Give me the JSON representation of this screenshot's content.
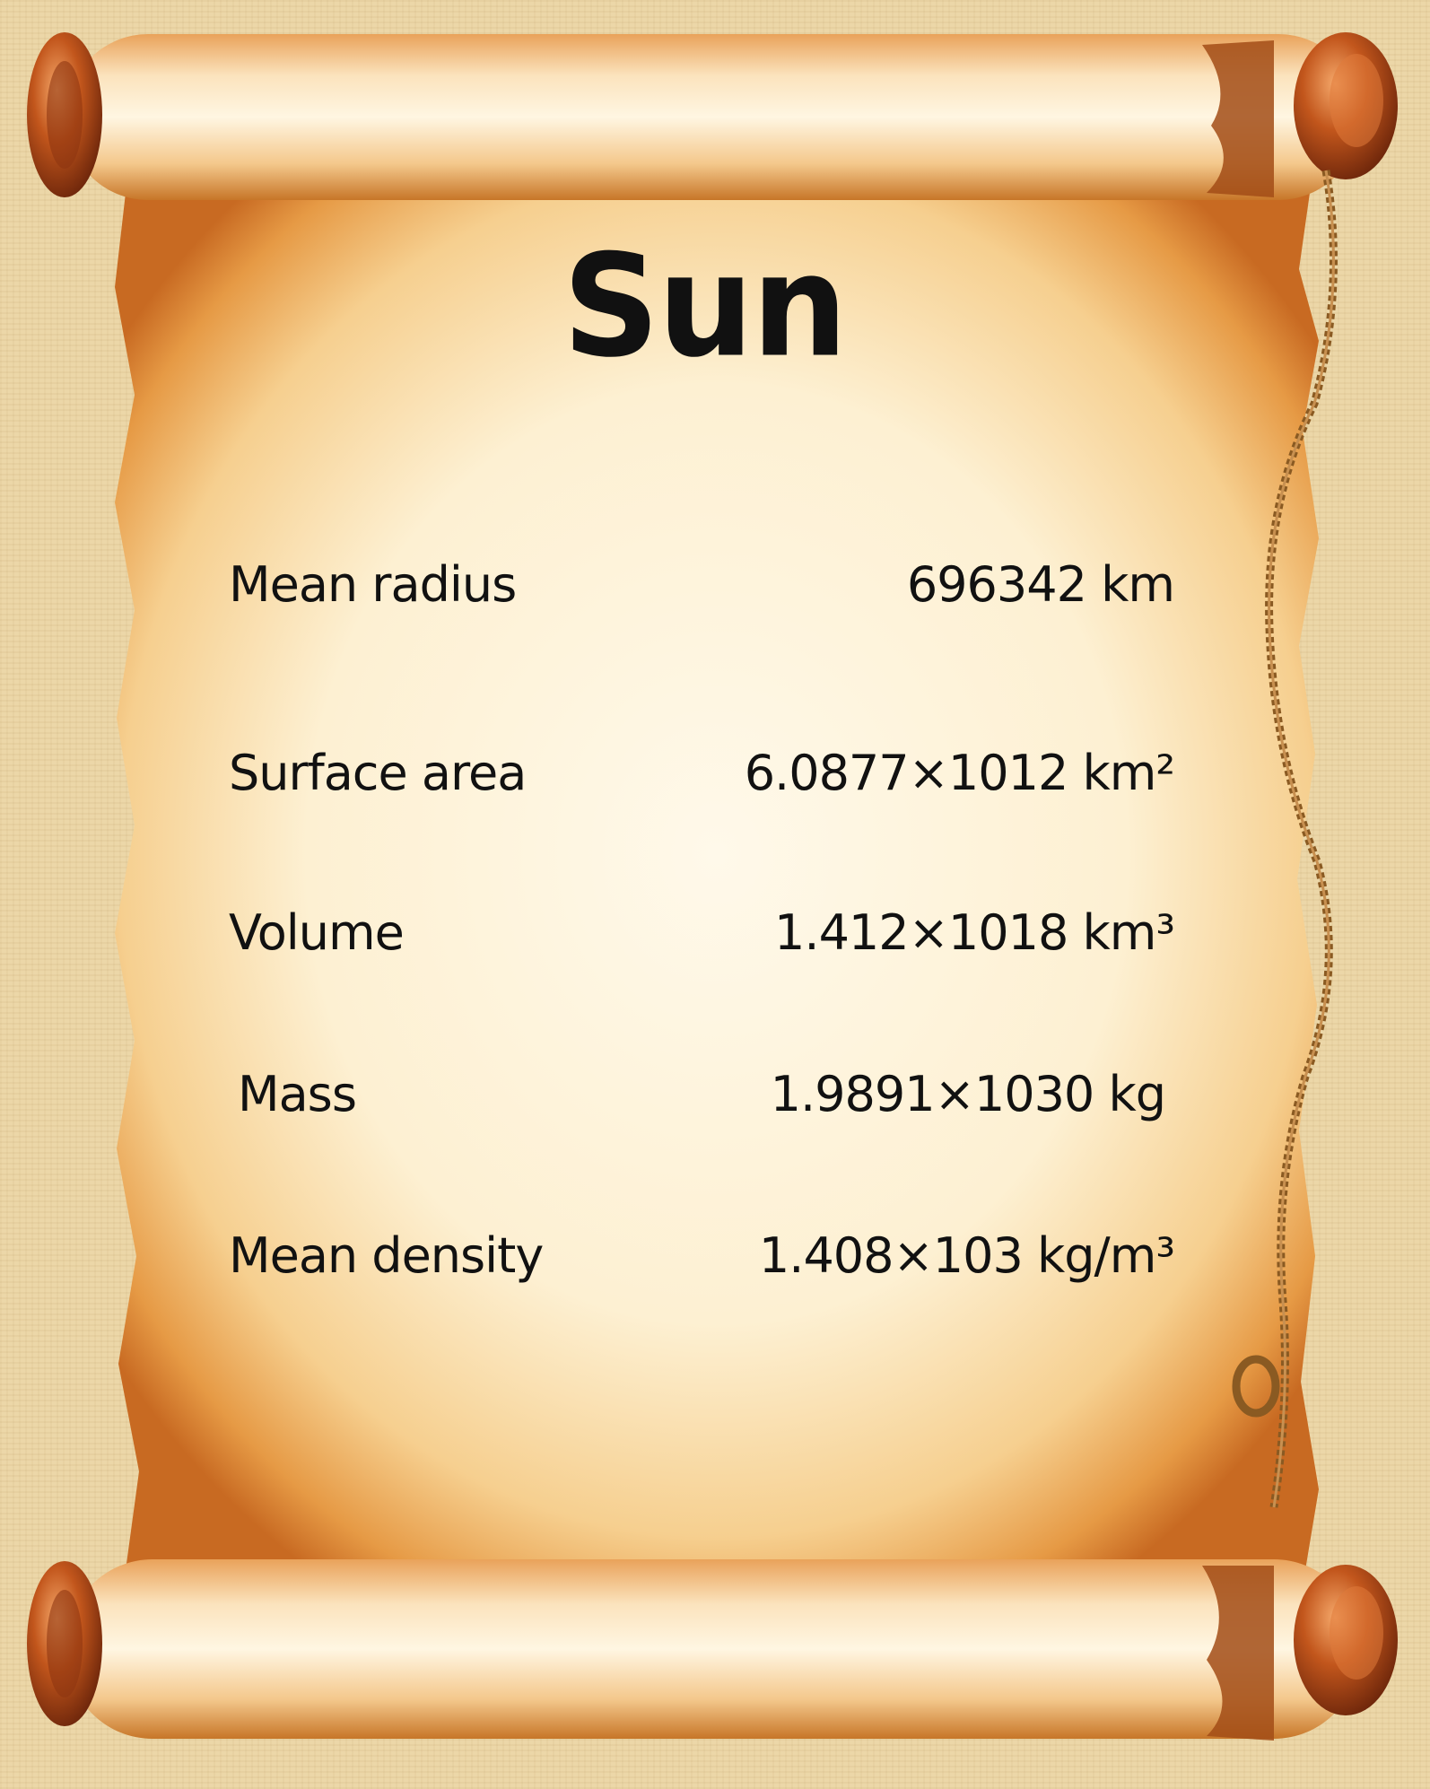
{
  "title": "Sun",
  "rows": [
    {
      "label": "Mean radius",
      "value": "696342 km"
    },
    {
      "label": "Surface area",
      "value": "6.0877×1012 km²"
    },
    {
      "label": "Volume",
      "value": "1.412×1018 km³"
    },
    {
      "label": "Mass",
      "value": "1.9891×1030 kg"
    },
    {
      "label": "Mean density",
      "value": "1.408×103 kg/m³"
    }
  ],
  "colors": {
    "background": "#ecd7a8",
    "parchment_center": "#fdf3dc",
    "parchment_edge": "#d98a3a",
    "roller_knob": "#b8531c",
    "rope": "#8a5a22",
    "text": "#111111"
  }
}
